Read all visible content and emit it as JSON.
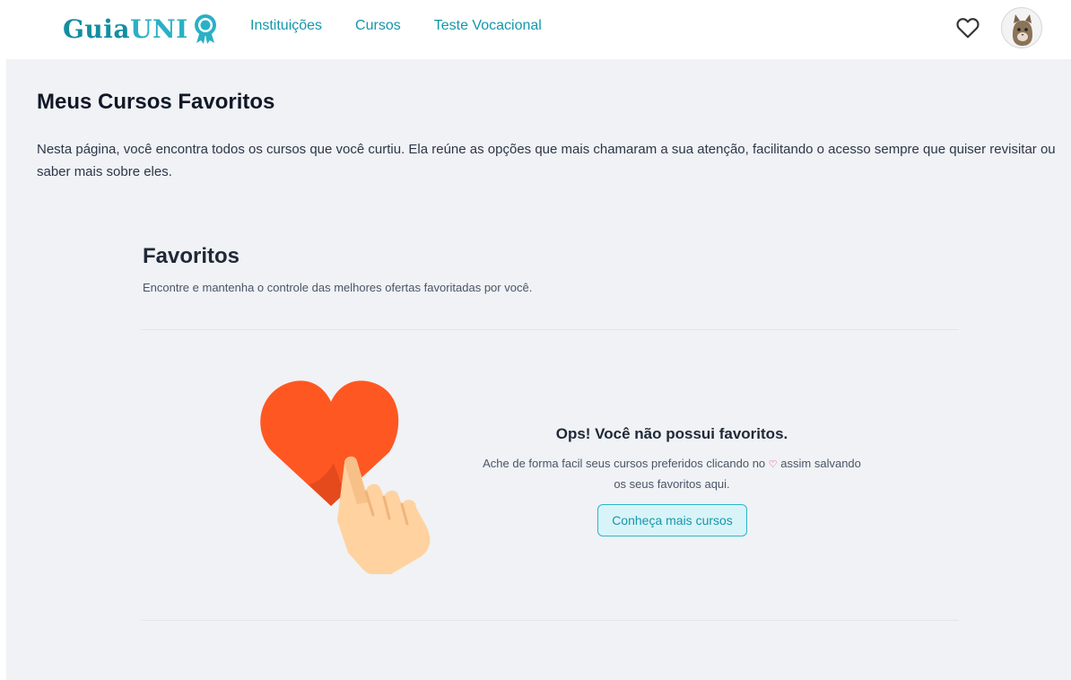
{
  "header": {
    "logo_main": "Guia",
    "logo_accent": "UNI",
    "nav": [
      "Instituições",
      "Cursos",
      "Teste Vocacional"
    ]
  },
  "page": {
    "title": "Meus Cursos Favoritos",
    "description": "Nesta página, você encontra todos os cursos que você curtiu. Ela reúne as opções que mais chamaram a sua atenção, facilitando o acesso sempre que quiser revisitar ou saber mais sobre eles."
  },
  "favorites": {
    "title": "Favoritos",
    "subtitle": "Encontre e mantenha o controle das melhores ofertas favoritadas por você."
  },
  "empty_state": {
    "title": "Ops! Você não possui favoritos.",
    "text_before": "Ache de forma facil seus cursos preferidos clicando no",
    "heart_glyph": "♡",
    "text_after": "assim salvando os seus favoritos aqui.",
    "button_label": "Conheça mais cursos"
  },
  "colors": {
    "brand": "#128ea1",
    "link": "#1497ab",
    "heart": "#ff5722",
    "background": "#f0f2f5"
  },
  "icons": {
    "nav_heart": "heart-outline-icon",
    "logo_badge": "award-badge-icon",
    "illustration": "heart-hand-illustration"
  }
}
